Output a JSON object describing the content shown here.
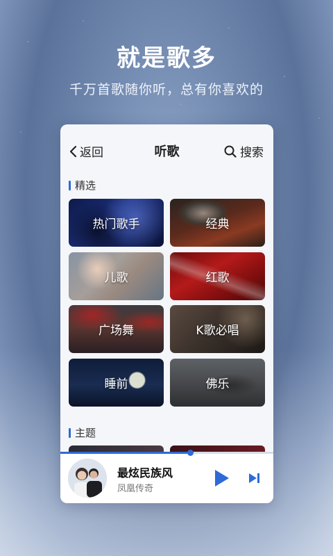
{
  "hero": {
    "title": "就是歌多",
    "subtitle": "千万首歌随你听，总有你喜欢的"
  },
  "header": {
    "back_label": "返回",
    "title": "听歌",
    "search_label": "搜索"
  },
  "sections": [
    {
      "label": "精选"
    },
    {
      "label": "主题"
    }
  ],
  "tiles": [
    {
      "label": "热门歌手"
    },
    {
      "label": "经典"
    },
    {
      "label": "儿歌"
    },
    {
      "label": "红歌"
    },
    {
      "label": "广场舞"
    },
    {
      "label": "K歌必唱"
    },
    {
      "label": "睡前"
    },
    {
      "label": "佛乐"
    }
  ],
  "player": {
    "song": "最炫民族风",
    "artist": "凤凰传奇",
    "progress": 0.61
  },
  "colors": {
    "accent": "#2e6bd6",
    "card_bg": "#f4f6f9"
  }
}
